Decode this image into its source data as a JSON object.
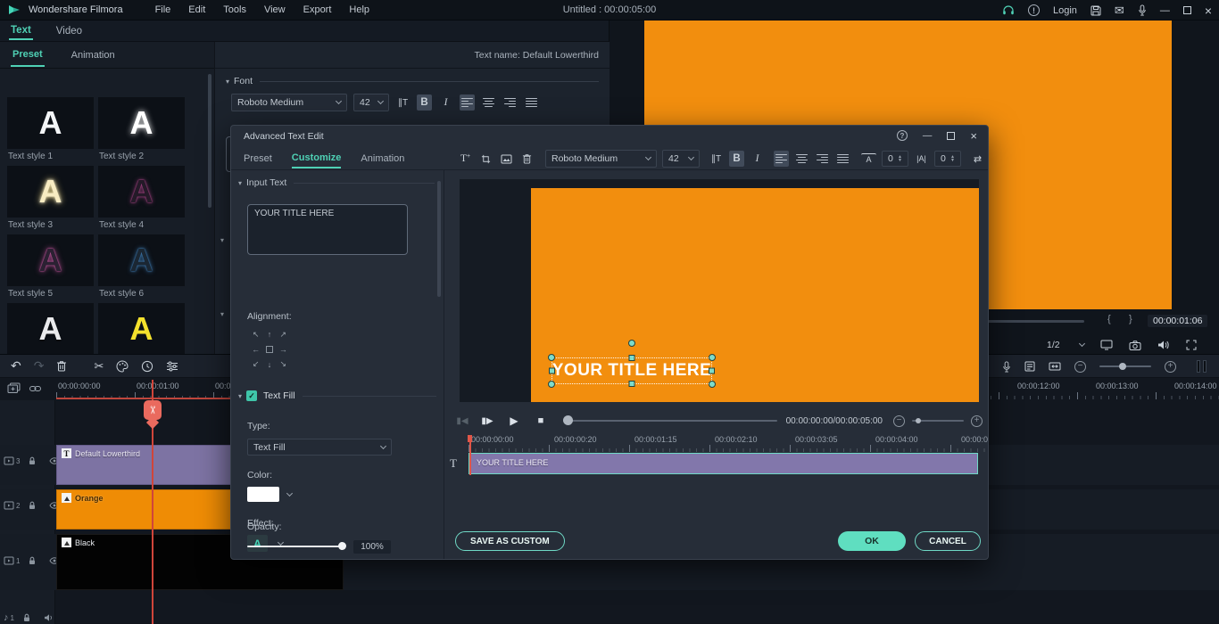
{
  "app": {
    "brand": "Wondershare Filmora",
    "title": "Untitled : 00:00:05:00",
    "menus": [
      "File",
      "Edit",
      "Tools",
      "View",
      "Export",
      "Help"
    ],
    "login": "Login"
  },
  "tabs": {
    "text": "Text",
    "video": "Video"
  },
  "left": {
    "preset_tab": "Preset",
    "animation_tab": "Animation",
    "styles": [
      {
        "glyph": "A",
        "label": "Text style 1"
      },
      {
        "glyph": "A",
        "label": "Text style 2"
      },
      {
        "glyph": "A",
        "label": "Text style 3"
      },
      {
        "glyph": "A",
        "label": "Text style 4"
      },
      {
        "glyph": "A",
        "label": "Text style 5"
      },
      {
        "glyph": "A",
        "label": "Text style 6"
      },
      {
        "glyph": "A",
        "label": ""
      },
      {
        "glyph": "A",
        "label": ""
      }
    ],
    "save_as_custom": "SAVE AS CUSTOM"
  },
  "font_panel": {
    "text_name": "Text name: Default Lowerthird",
    "section": "Font",
    "font": "Roboto Medium",
    "size": "42",
    "bold": "B",
    "italic": "I",
    "input_preview": "YOUR TITLE HERE"
  },
  "preview": {
    "timecode": "00:00:01:06",
    "zoom": "1/2"
  },
  "timeline": {
    "ruler_left": [
      "00:00:00:00",
      "00:00:01:00",
      "00:0"
    ],
    "ruler_right": [
      "00:00:12:00",
      "00:00:13:00",
      "00:00:14:00"
    ],
    "tracks": [
      {
        "num": "3",
        "clip": "Default Lowerthird"
      },
      {
        "num": "2",
        "clip": "Orange"
      },
      {
        "num": "1",
        "clip": "Black"
      }
    ],
    "audio_track_num": "1"
  },
  "dialog": {
    "title": "Advanced Text Edit",
    "tab_preset": "Preset",
    "tab_customize": "Customize",
    "tab_animation": "Animation",
    "input_section": "Input Text",
    "input_value": "YOUR TITLE HERE",
    "alignment_label": "Alignment:",
    "fill_section": "Text Fill",
    "type_label": "Type:",
    "type_value": "Text Fill",
    "color_label": "Color:",
    "effect_label": "Effect:",
    "effect_glyph": "A",
    "opacity_label": "Opacity:",
    "opacity_value": "100%",
    "toolbar": {
      "font": "Roboto Medium",
      "size": "42",
      "bold": "B",
      "italic": "I",
      "spin1": "0",
      "spin2": "0"
    },
    "canvas_text": "YOUR TITLE HERE",
    "playback_timecode": "00:00:00:00/00:00:05:00",
    "ruler": [
      "00:00:00:00",
      "00:00:00:20",
      "00:00:01:15",
      "00:00:02:10",
      "00:00:03:05",
      "00:00:04:00",
      "00:00:0"
    ],
    "track_label": "YOUR TITLE HERE",
    "save_button": "SAVE AS CUSTOM",
    "ok_button": "OK",
    "cancel_button": "CANCEL"
  },
  "colors": {
    "accent": "#57d9bd",
    "orange": "#f28e0e",
    "clip_purple": "#8277ab",
    "playhead_red": "#e0584a",
    "ok_button": "#5fdec0"
  }
}
